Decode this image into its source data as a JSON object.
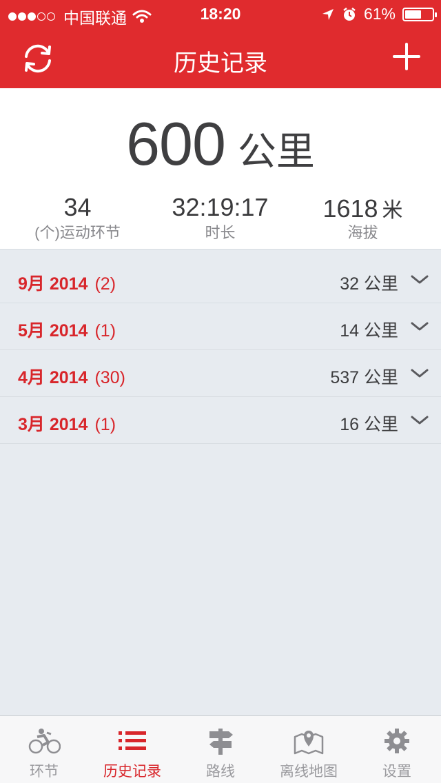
{
  "status_bar": {
    "carrier": "中国联通",
    "time": "18:20",
    "battery": "61%",
    "battery_level": 0.61,
    "signal_bars_filled": 3,
    "signal_bars_total": 5
  },
  "nav": {
    "title": "历史记录",
    "left_icon": "refresh-icon",
    "right_icon": "plus-icon"
  },
  "summary": {
    "total_distance": "600",
    "total_unit": "公里",
    "stats": [
      {
        "value": "34",
        "unit": "",
        "label": "(个)运动环节"
      },
      {
        "value": "32:19:17",
        "unit": "",
        "label": "时长"
      },
      {
        "value": "1618",
        "unit": "米",
        "label": "海拔"
      }
    ]
  },
  "months": [
    {
      "month": "9月 2014",
      "count": "(2)",
      "distance": "32 公里"
    },
    {
      "month": "5月 2014",
      "count": "(1)",
      "distance": "14 公里"
    },
    {
      "month": "4月 2014",
      "count": "(30)",
      "distance": "537 公里"
    },
    {
      "month": "3月 2014",
      "count": "(1)",
      "distance": "16 公里"
    }
  ],
  "tabs": [
    {
      "label": "环节",
      "icon": "cycling-icon",
      "active": false
    },
    {
      "label": "历史记录",
      "icon": "list-icon",
      "active": true
    },
    {
      "label": "路线",
      "icon": "signpost-icon",
      "active": false
    },
    {
      "label": "离线地图",
      "icon": "map-pin-icon",
      "active": false
    },
    {
      "label": "设置",
      "icon": "gear-icon",
      "active": false
    }
  ],
  "colors": {
    "brand_red": "#e02b2e",
    "accent_text_red": "#d8262b",
    "list_background": "#e7ebf0",
    "inactive_tab": "#9a9a9e"
  }
}
